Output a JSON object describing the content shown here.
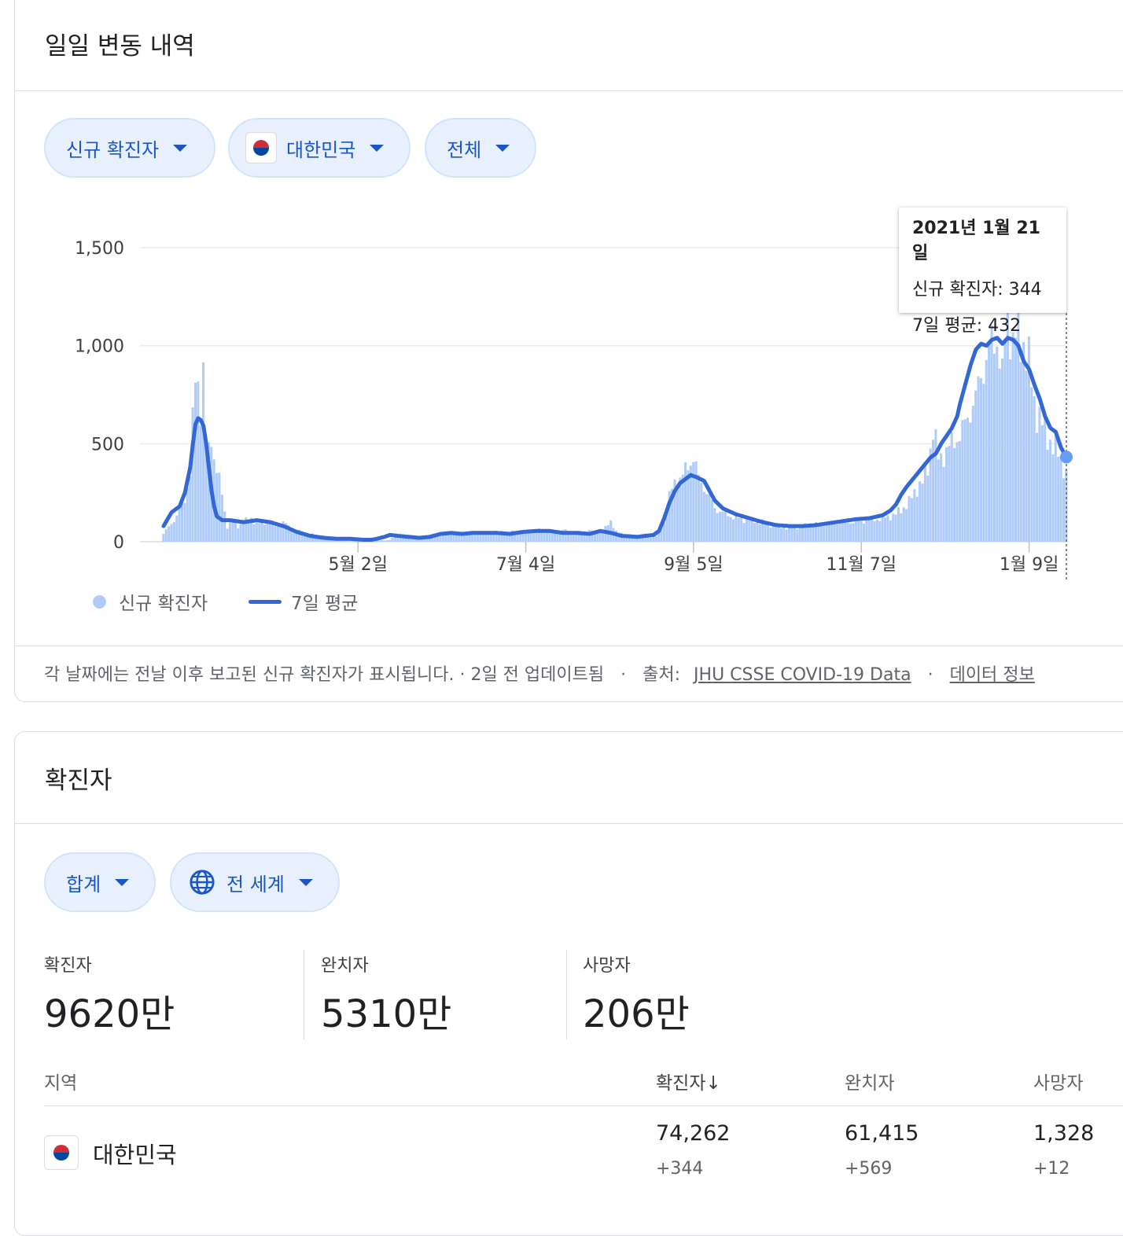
{
  "daily_card": {
    "title": "일일 변동 내역",
    "chips": [
      {
        "label": "신규 확진자"
      },
      {
        "label": "대한민국"
      },
      {
        "label": "전체"
      }
    ],
    "tooltip": {
      "date": "2021년 1월 21일",
      "line1": "신규 확진자: 344",
      "line2": "7일 평균: 432"
    },
    "legend": {
      "bars": "신규 확진자",
      "line": "7일 평균"
    },
    "footnote": {
      "text": "각 날짜에는 전날 이후 보고된 신규 확진자가 표시됩니다. · 2일 전 업데이트됨",
      "source_prefix": "출처:",
      "source_link": "JHU CSSE COVID-19 Data",
      "info_link": "데이터 정보",
      "dot": "·"
    }
  },
  "chart_data": {
    "type": "bar",
    "x_axis": "2020-02-19 → 2021-01-21 (daily)",
    "x_ticks": [
      "5월 2일",
      "7월 4일",
      "9월 5일",
      "11월 7일",
      "1월 9일"
    ],
    "y_ticks": [
      "0",
      "500",
      "1,000",
      "1,500"
    ],
    "ylim": [
      0,
      1500
    ],
    "grid": true,
    "legend_position": "bottom-left",
    "colors": {
      "bars": "#aecbfa",
      "line": "#3367d6"
    },
    "series": [
      {
        "name": "신규 확진자",
        "type": "bar",
        "keypoints": [
          [
            0,
            40
          ],
          [
            5,
            130
          ],
          [
            8,
            220
          ],
          [
            10,
            350
          ],
          [
            11,
            600
          ],
          [
            12,
            820
          ],
          [
            13,
            810
          ],
          [
            14,
            700
          ],
          [
            15,
            850
          ],
          [
            16,
            520
          ],
          [
            17,
            450
          ],
          [
            18,
            560
          ],
          [
            19,
            420
          ],
          [
            20,
            380
          ],
          [
            21,
            300
          ],
          [
            22,
            250
          ],
          [
            23,
            150
          ],
          [
            24,
            80
          ],
          [
            26,
            100
          ],
          [
            28,
            80
          ],
          [
            30,
            100
          ],
          [
            33,
            120
          ],
          [
            35,
            90
          ],
          [
            38,
            100
          ],
          [
            40,
            110
          ],
          [
            42,
            80
          ],
          [
            45,
            100
          ],
          [
            48,
            70
          ],
          [
            50,
            60
          ],
          [
            55,
            40
          ],
          [
            60,
            30
          ],
          [
            65,
            20
          ],
          [
            70,
            10
          ],
          [
            75,
            10
          ],
          [
            80,
            5
          ],
          [
            85,
            10
          ],
          [
            88,
            30
          ],
          [
            90,
            25
          ],
          [
            93,
            15
          ],
          [
            96,
            25
          ],
          [
            100,
            20
          ],
          [
            105,
            40
          ],
          [
            108,
            50
          ],
          [
            112,
            40
          ],
          [
            116,
            50
          ],
          [
            120,
            45
          ],
          [
            125,
            50
          ],
          [
            130,
            50
          ],
          [
            135,
            45
          ],
          [
            140,
            60
          ],
          [
            145,
            55
          ],
          [
            150,
            60
          ],
          [
            155,
            50
          ],
          [
            160,
            55
          ],
          [
            165,
            50
          ],
          [
            168,
            110
          ],
          [
            170,
            50
          ],
          [
            175,
            30
          ],
          [
            180,
            20
          ],
          [
            185,
            30
          ],
          [
            188,
            100
          ],
          [
            190,
            230
          ],
          [
            192,
            300
          ],
          [
            195,
            340
          ],
          [
            197,
            380
          ],
          [
            199,
            440
          ],
          [
            201,
            320
          ],
          [
            203,
            280
          ],
          [
            205,
            230
          ],
          [
            207,
            170
          ],
          [
            210,
            150
          ],
          [
            215,
            120
          ],
          [
            220,
            110
          ],
          [
            225,
            100
          ],
          [
            230,
            80
          ],
          [
            235,
            70
          ],
          [
            240,
            80
          ],
          [
            245,
            90
          ],
          [
            250,
            90
          ],
          [
            255,
            100
          ],
          [
            260,
            100
          ],
          [
            265,
            110
          ],
          [
            270,
            120
          ],
          [
            275,
            140
          ],
          [
            280,
            200
          ],
          [
            283,
            280
          ],
          [
            285,
            300
          ],
          [
            287,
            380
          ],
          [
            289,
            580
          ],
          [
            291,
            420
          ],
          [
            293,
            450
          ],
          [
            295,
            480
          ],
          [
            297,
            520
          ],
          [
            300,
            560
          ],
          [
            303,
            680
          ],
          [
            305,
            720
          ],
          [
            307,
            860
          ],
          [
            309,
            930
          ],
          [
            311,
            1010
          ],
          [
            313,
            1050
          ],
          [
            315,
            830
          ],
          [
            317,
            1170
          ],
          [
            319,
            1020
          ],
          [
            321,
            1040
          ],
          [
            323,
            1030
          ],
          [
            325,
            900
          ],
          [
            327,
            710
          ],
          [
            329,
            640
          ],
          [
            331,
            560
          ],
          [
            333,
            520
          ],
          [
            335,
            470
          ],
          [
            337,
            420
          ],
          [
            338,
            390
          ],
          [
            339,
            344
          ]
        ]
      },
      {
        "name": "7일 평균",
        "type": "line",
        "keypoints": [
          [
            0,
            80
          ],
          [
            3,
            150
          ],
          [
            6,
            180
          ],
          [
            8,
            250
          ],
          [
            10,
            380
          ],
          [
            11,
            500
          ],
          [
            12,
            600
          ],
          [
            13,
            630
          ],
          [
            14,
            620
          ],
          [
            15,
            590
          ],
          [
            16,
            500
          ],
          [
            17,
            380
          ],
          [
            18,
            260
          ],
          [
            19,
            180
          ],
          [
            20,
            130
          ],
          [
            22,
            110
          ],
          [
            25,
            110
          ],
          [
            30,
            100
          ],
          [
            35,
            110
          ],
          [
            40,
            100
          ],
          [
            45,
            80
          ],
          [
            50,
            50
          ],
          [
            55,
            30
          ],
          [
            60,
            20
          ],
          [
            65,
            15
          ],
          [
            70,
            15
          ],
          [
            75,
            10
          ],
          [
            78,
            10
          ],
          [
            80,
            15
          ],
          [
            83,
            25
          ],
          [
            85,
            35
          ],
          [
            88,
            30
          ],
          [
            92,
            25
          ],
          [
            96,
            20
          ],
          [
            100,
            25
          ],
          [
            104,
            40
          ],
          [
            108,
            45
          ],
          [
            112,
            40
          ],
          [
            116,
            45
          ],
          [
            120,
            45
          ],
          [
            125,
            45
          ],
          [
            130,
            40
          ],
          [
            135,
            50
          ],
          [
            140,
            55
          ],
          [
            145,
            55
          ],
          [
            150,
            45
          ],
          [
            155,
            45
          ],
          [
            160,
            40
          ],
          [
            164,
            55
          ],
          [
            168,
            45
          ],
          [
            172,
            30
          ],
          [
            178,
            25
          ],
          [
            184,
            35
          ],
          [
            186,
            55
          ],
          [
            188,
            120
          ],
          [
            190,
            200
          ],
          [
            192,
            260
          ],
          [
            194,
            300
          ],
          [
            196,
            320
          ],
          [
            198,
            340
          ],
          [
            200,
            330
          ],
          [
            203,
            310
          ],
          [
            205,
            260
          ],
          [
            207,
            210
          ],
          [
            210,
            170
          ],
          [
            215,
            140
          ],
          [
            220,
            120
          ],
          [
            225,
            100
          ],
          [
            230,
            85
          ],
          [
            235,
            80
          ],
          [
            240,
            80
          ],
          [
            245,
            85
          ],
          [
            250,
            95
          ],
          [
            255,
            105
          ],
          [
            260,
            115
          ],
          [
            265,
            120
          ],
          [
            270,
            135
          ],
          [
            273,
            160
          ],
          [
            275,
            190
          ],
          [
            277,
            240
          ],
          [
            279,
            280
          ],
          [
            282,
            330
          ],
          [
            285,
            380
          ],
          [
            288,
            430
          ],
          [
            290,
            450
          ],
          [
            292,
            500
          ],
          [
            294,
            540
          ],
          [
            296,
            580
          ],
          [
            298,
            640
          ],
          [
            299,
            700
          ],
          [
            301,
            800
          ],
          [
            303,
            900
          ],
          [
            305,
            980
          ],
          [
            307,
            1010
          ],
          [
            309,
            1000
          ],
          [
            311,
            1030
          ],
          [
            313,
            1040
          ],
          [
            315,
            1010
          ],
          [
            317,
            1040
          ],
          [
            319,
            1030
          ],
          [
            321,
            1000
          ],
          [
            323,
            920
          ],
          [
            325,
            880
          ],
          [
            327,
            800
          ],
          [
            329,
            730
          ],
          [
            331,
            640
          ],
          [
            333,
            580
          ],
          [
            335,
            560
          ],
          [
            337,
            480
          ],
          [
            339,
            432
          ]
        ]
      }
    ]
  },
  "cases_card": {
    "title": "확진자",
    "chips": [
      {
        "label": "합계"
      },
      {
        "label": "전 세계"
      }
    ],
    "stats": [
      {
        "label": "확진자",
        "value": "9620만"
      },
      {
        "label": "완치자",
        "value": "5310만"
      },
      {
        "label": "사망자",
        "value": "206만"
      }
    ],
    "table": {
      "headers": {
        "region": "지역",
        "cases": "확진자",
        "sort_arrow": "↓",
        "recovered": "완치자",
        "deaths": "사망자"
      },
      "rows": [
        {
          "region": "대한민국",
          "cases": "74,262",
          "cases_delta": "+344",
          "recovered": "61,415",
          "recovered_delta": "+569",
          "deaths": "1,328",
          "deaths_delta": "+12"
        }
      ]
    }
  }
}
